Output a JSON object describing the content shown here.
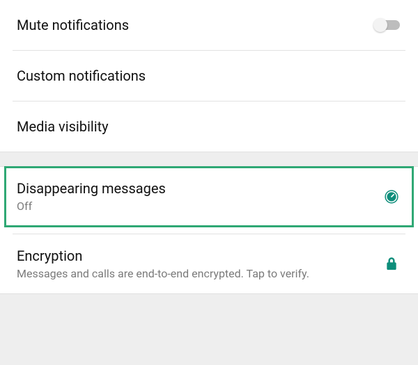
{
  "section1": {
    "mute": {
      "title": "Mute notifications",
      "on": false
    },
    "custom": {
      "title": "Custom notifications"
    },
    "media": {
      "title": "Media visibility"
    }
  },
  "section2": {
    "disappearing": {
      "title": "Disappearing messages",
      "sub": "Off"
    },
    "encryption": {
      "title": "Encryption",
      "sub": "Messages and calls are end-to-end encrypted. Tap to verify."
    }
  },
  "colors": {
    "accent": "#0e8e7b"
  }
}
